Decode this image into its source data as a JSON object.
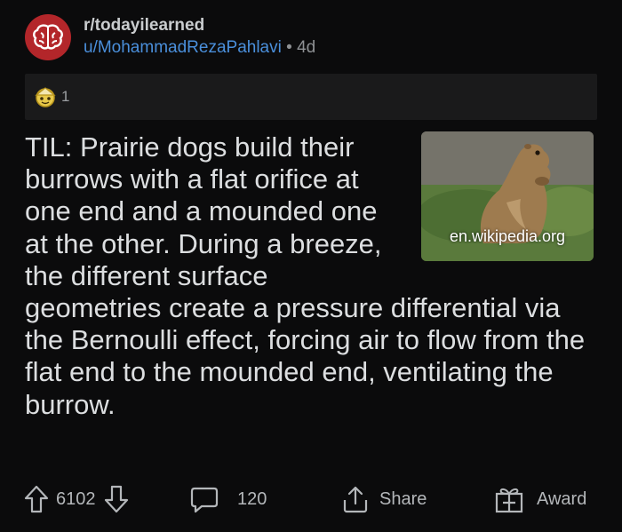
{
  "post": {
    "subreddit": "r/todayilearned",
    "author": "u/MohammadRezaPahlavi",
    "separator": "•",
    "age": "4d",
    "award_count": "1",
    "title": "TIL: Prairie dogs build their burrows with a flat orifice at one end and a mounded one at the other. During a breeze, the different surface geometries create a pressure differential via the Bernoulli effect, forcing air to flow from the flat end to the mounded end, ventilating the burrow.",
    "link_domain": "en.wikipedia.org"
  },
  "actions": {
    "score": "6102",
    "comments": "120",
    "share_label": "Share",
    "award_label": "Award"
  },
  "colors": {
    "background": "#0b0b0c",
    "subreddit_avatar": "#b3262a",
    "author_link": "#4a8fdb",
    "awards_bar": "#1a1a1b",
    "text": "#dcdee0"
  },
  "icons": {
    "subreddit": "brain-icon",
    "award": "helpful-award-icon",
    "upvote": "arrow-up-icon",
    "downvote": "arrow-down-icon",
    "comments": "speech-bubble-icon",
    "share": "share-icon",
    "award_button": "gift-icon"
  }
}
